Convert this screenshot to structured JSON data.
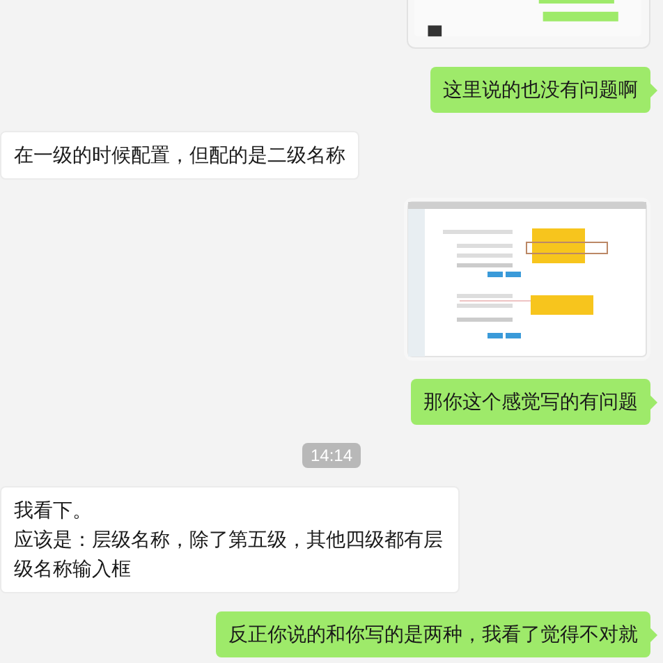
{
  "messages": [
    {
      "kind": "image"
    },
    {
      "kind": "sent",
      "lines": [
        "这里说的也没有问题啊"
      ]
    },
    {
      "kind": "received",
      "lines": [
        "在一级的时候配置，但配的是二级名称"
      ]
    },
    {
      "kind": "image"
    },
    {
      "kind": "sent",
      "lines": [
        "那你这个感觉写的有问题"
      ]
    },
    {
      "kind": "time",
      "text": "14:14"
    },
    {
      "kind": "received",
      "lines": [
        "我看下。",
        "应该是：层级名称，除了第五级，其他四级都有层级名称输入框"
      ]
    },
    {
      "kind": "sent",
      "lines": [
        "反正你说的和你写的是两种，我看了觉得不对就"
      ]
    }
  ]
}
